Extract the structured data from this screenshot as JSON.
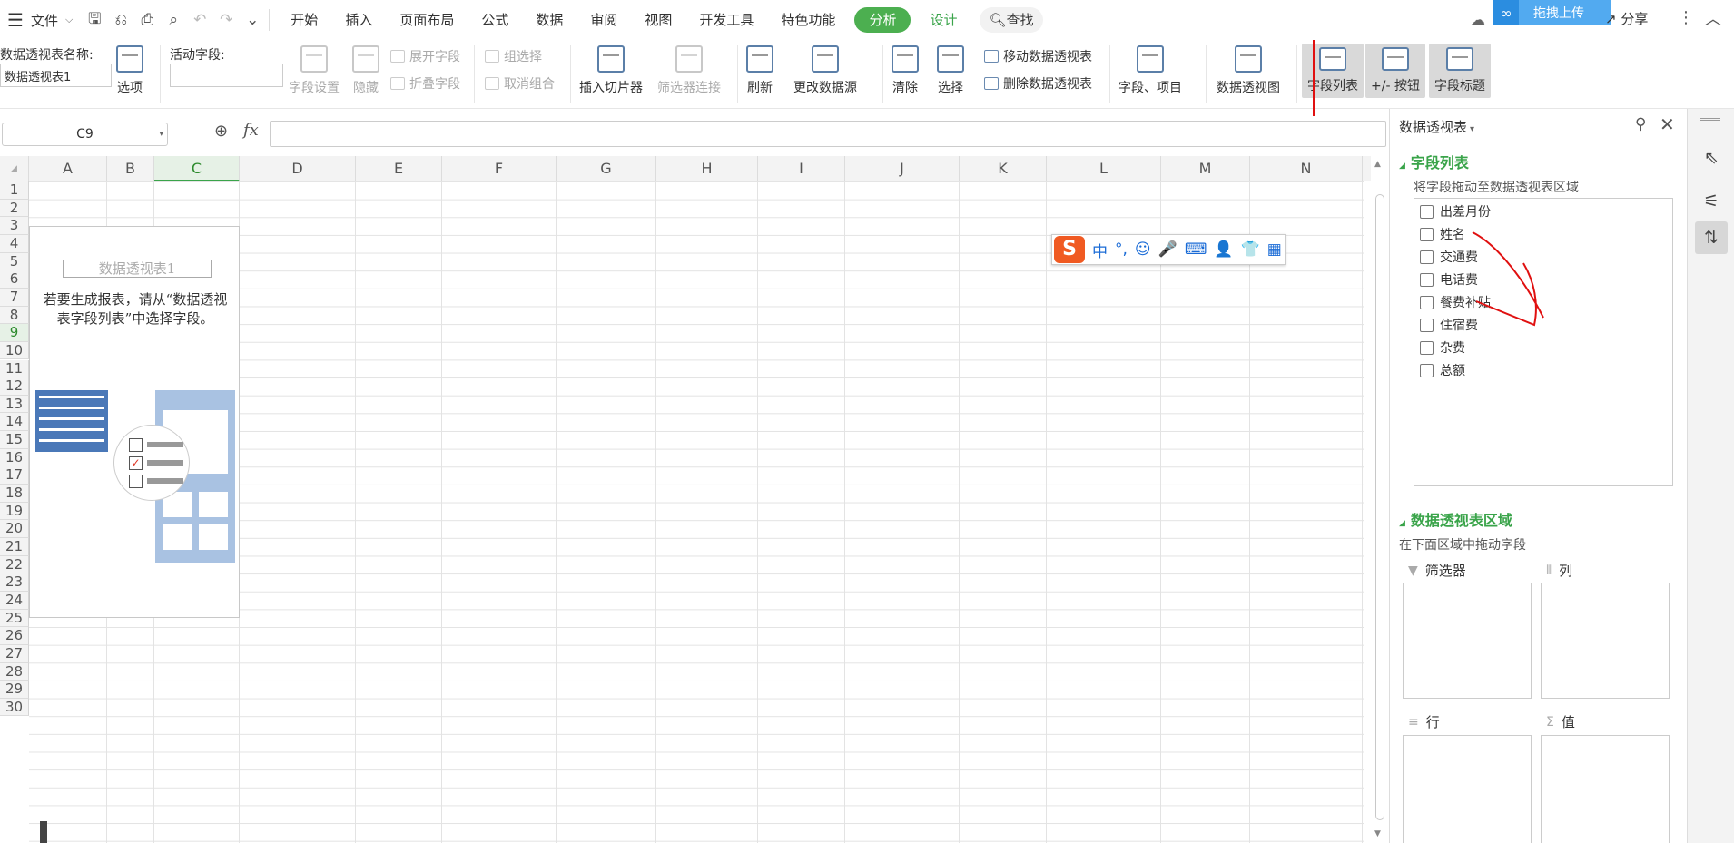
{
  "menubar": {
    "file_label": "文件",
    "tabs": [
      "开始",
      "插入",
      "页面布局",
      "公式",
      "数据",
      "审阅",
      "视图",
      "开发工具",
      "特色功能",
      "分析",
      "设计"
    ],
    "active_tab": "分析",
    "search_label": "查找",
    "upload_label": "拖拽上传",
    "share_label": "分享"
  },
  "ribbon": {
    "pt_name_label": "数据透视表名称:",
    "pt_name_value": "数据透视表1",
    "options_label": "选项",
    "active_field_label": "活动字段:",
    "field_settings": "字段设置",
    "hide": "隐藏",
    "expand_field": "展开字段",
    "collapse_field": "折叠字段",
    "group_select": "组选择",
    "ungroup": "取消组合",
    "insert_slicer": "插入切片器",
    "filter_conn": "筛选器连接",
    "refresh": "刷新",
    "change_source": "更改数据源",
    "clear": "清除",
    "select": "选择",
    "move_pt": "移动数据透视表",
    "delete_pt": "删除数据透视表",
    "fields_items": "字段、项目",
    "pivot_chart": "数据透视图",
    "field_list": "字段列表",
    "plus_minus": "+/- 按钮",
    "field_header": "字段标题"
  },
  "formula_bar": {
    "name_box": "C9",
    "fx": "fx",
    "formula": ""
  },
  "sheet": {
    "columns": [
      "A",
      "B",
      "C",
      "D",
      "E",
      "F",
      "G",
      "H",
      "I",
      "J",
      "K",
      "L",
      "M",
      "N"
    ],
    "rows": [
      "1",
      "2",
      "3",
      "4",
      "5",
      "6",
      "7",
      "8",
      "9",
      "10",
      "11",
      "12",
      "13",
      "14",
      "15",
      "16",
      "17",
      "18",
      "19",
      "20",
      "21",
      "22",
      "23",
      "24",
      "25",
      "26",
      "27",
      "28",
      "29",
      "30"
    ],
    "selected_col": "C",
    "selected_row": "9"
  },
  "pivot_placeholder": {
    "title": "数据透视表1",
    "hint": "若要生成报表，请从“数据透视表字段列表”中选择字段。"
  },
  "ime": {
    "chars": [
      "中",
      "°,",
      "☺",
      "🎤",
      "⌨",
      "👤",
      "👕",
      "▦"
    ]
  },
  "panel": {
    "title": "数据透视表",
    "field_list_title": "字段列表",
    "field_list_sub": "将字段拖动至数据透视表区域",
    "fields": [
      "出差月份",
      "姓名",
      "交通费",
      "电话费",
      "餐费补贴",
      "住宿费",
      "杂费",
      "总额"
    ],
    "area_title": "数据透视表区域",
    "area_sub": "在下面区域中拖动字段",
    "zone_filter": "筛选器",
    "zone_col": "列",
    "zone_row": "行",
    "zone_val": "值"
  },
  "colors": {
    "accent_green": "#3aa44a",
    "active_tab_bg": "#4caf50",
    "annotation_red": "#e01010"
  }
}
